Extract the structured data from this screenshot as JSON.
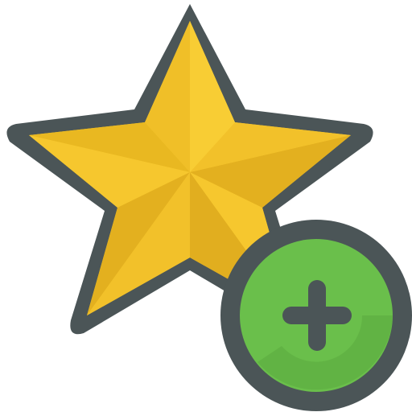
{
  "icon": {
    "name": "add-to-favorites-icon",
    "parts": {
      "star": "star-icon",
      "badge": "add-badge",
      "plus": "plus-icon"
    }
  },
  "colors": {
    "outline": "#4b5557",
    "star_light": "#f6c72e",
    "star_dark": "#e6b522",
    "badge_green": "#6abf4b",
    "badge_shadow": "#5cab3f",
    "plus": "#4b5557"
  }
}
